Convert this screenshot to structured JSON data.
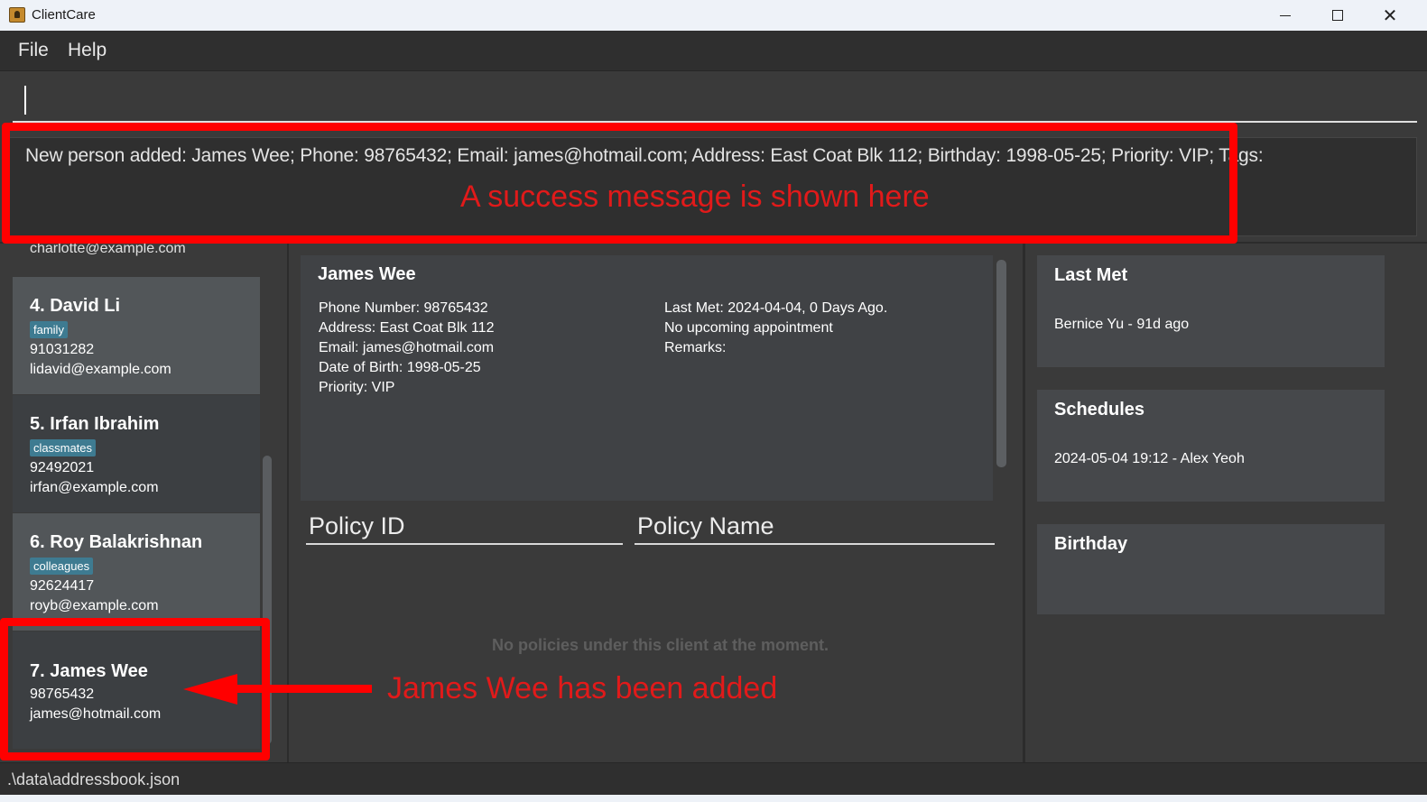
{
  "window": {
    "title": "ClientCare",
    "minimize_icon": "minimize-icon",
    "maximize_icon": "maximize-icon",
    "close_glyph": "✕"
  },
  "menu": {
    "items": [
      {
        "label": "File"
      },
      {
        "label": "Help"
      }
    ]
  },
  "command_box": {
    "value": ""
  },
  "result_display": {
    "text": "New person added: James Wee; Phone: 98765432; Email: james@hotmail.com; Address: East Coat Blk 112; Birthday: 1998-05-25; Priority: VIP; Tags:"
  },
  "annotations": {
    "result_note": "A success message is shown here",
    "added_note": "James Wee has been added",
    "color": "#ff0000"
  },
  "person_list": {
    "partial_email": "charlotte@example.com",
    "cards": [
      {
        "name": "4.  David Li",
        "tag": "family",
        "phone": "91031282",
        "email": "lidavid@example.com"
      },
      {
        "name": "5.  Irfan Ibrahim",
        "tag": "classmates",
        "phone": "92492021",
        "email": "irfan@example.com"
      },
      {
        "name": "6.  Roy Balakrishnan",
        "tag": "colleagues",
        "phone": "92624417",
        "email": "royb@example.com"
      },
      {
        "name": "7.  James Wee",
        "phone": "98765432",
        "email": "james@hotmail.com"
      }
    ]
  },
  "detail": {
    "name": "James Wee",
    "phone": "Phone Number: 98765432",
    "address": "Address: East Coat Blk 112",
    "email": "Email: james@hotmail.com",
    "dob": "Date of Birth: 1998-05-25",
    "priority": "Priority: VIP",
    "last_met": "Last Met: 2024-04-04, 0 Days Ago.",
    "appointment": "No upcoming appointment",
    "remarks": "Remarks:"
  },
  "policy_table": {
    "columns": [
      "Policy ID",
      "Policy Name"
    ],
    "empty_message": "No policies under this client at the moment."
  },
  "side_panels": {
    "last_met": {
      "title": "Last Met",
      "entries": [
        "Bernice Yu - 91d ago"
      ]
    },
    "schedules": {
      "title": "Schedules",
      "entries": [
        "2024-05-04 19:12 - Alex Yeoh"
      ]
    },
    "birthday": {
      "title": "Birthday",
      "entries": []
    }
  },
  "status_bar": {
    "path": ".\\data\\addressbook.json"
  },
  "colors": {
    "tag_background": "#3e7b91",
    "selected_card": "#525659",
    "background": "#3a3a3a"
  }
}
